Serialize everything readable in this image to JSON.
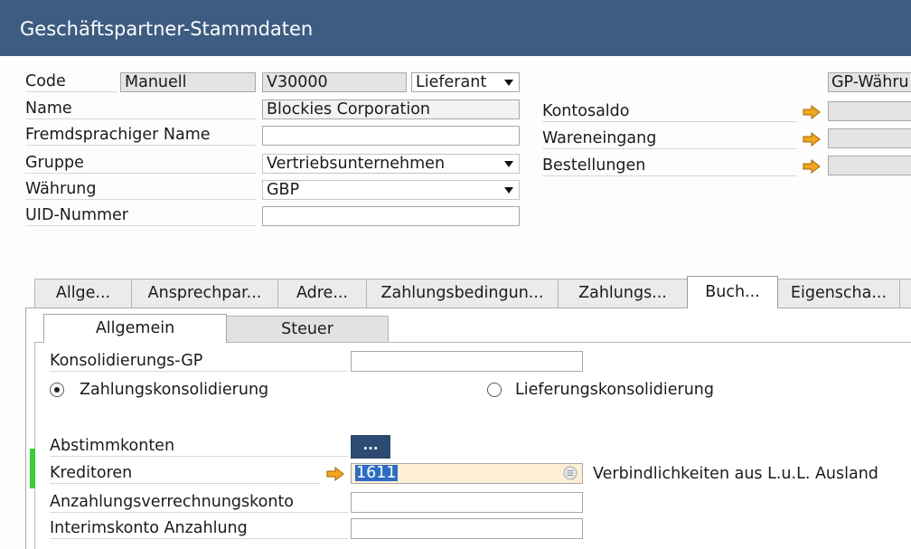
{
  "window": {
    "title": "Geschäftspartner-Stammdaten"
  },
  "header": {
    "code": {
      "label": "Code",
      "series": "Manuell",
      "value": "V30000",
      "type": "Lieferant"
    },
    "name": {
      "label": "Name",
      "value": "Blockies Corporation"
    },
    "foreign_name": {
      "label": "Fremdsprachiger Name",
      "value": ""
    },
    "group": {
      "label": "Gruppe",
      "value": "Vertriebsunternehmen"
    },
    "currency": {
      "label": "Währung",
      "value": "GBP"
    },
    "uid_number": {
      "label": "UID-Nummer",
      "value": ""
    },
    "bp_currency": {
      "value": "GP-Währu"
    },
    "account_balance": {
      "label": "Kontosaldo",
      "value": ""
    },
    "goods_receipt": {
      "label": "Wareneingang",
      "value": ""
    },
    "orders": {
      "label": "Bestellungen",
      "value": ""
    }
  },
  "tabs": [
    {
      "label": "Allge...",
      "selected": false
    },
    {
      "label": "Ansprechpar...",
      "selected": false
    },
    {
      "label": "Adre...",
      "selected": false
    },
    {
      "label": "Zahlungsbedingun...",
      "selected": false
    },
    {
      "label": "Zahlungs...",
      "selected": false
    },
    {
      "label": "Buch...",
      "selected": true
    },
    {
      "label": "Eigenscha...",
      "selected": false
    }
  ],
  "subtabs": [
    {
      "label": "Allgemein",
      "selected": true
    },
    {
      "label": "Steuer",
      "selected": false
    }
  ],
  "accounting": {
    "consolidation_bp": {
      "label": "Konsolidierungs-GP",
      "value": ""
    },
    "payment_consolidation": {
      "label": "Zahlungskonsolidierung",
      "checked": true
    },
    "delivery_consolidation": {
      "label": "Lieferungskonsolidierung",
      "checked": false
    },
    "control_accounts": {
      "label": "Abstimmkonten",
      "button_label": "..."
    },
    "creditors": {
      "label": "Kreditoren",
      "value": "1611",
      "description": "Verbindlichkeiten aus L.u.L. Ausland"
    },
    "down_payment_clearing": {
      "label": "Anzahlungsverrechnungskonto",
      "value": ""
    },
    "down_payment_interim": {
      "label": "Interimskonto Anzahlung",
      "value": ""
    }
  },
  "icons": {
    "link": "orange-link-arrow-icon",
    "dropdown": "chevron-down-icon",
    "choose_from_list": "choose-from-list-icon",
    "radio": "radio-button-icon"
  },
  "colors": {
    "title_bar": "#3d5c82",
    "link_arrow": "#f3a61b",
    "selection": "#2d6bc6",
    "active_field": "#fdeed4",
    "mandatory_marker": "#34d334",
    "button_bg": "#2c4a72"
  }
}
